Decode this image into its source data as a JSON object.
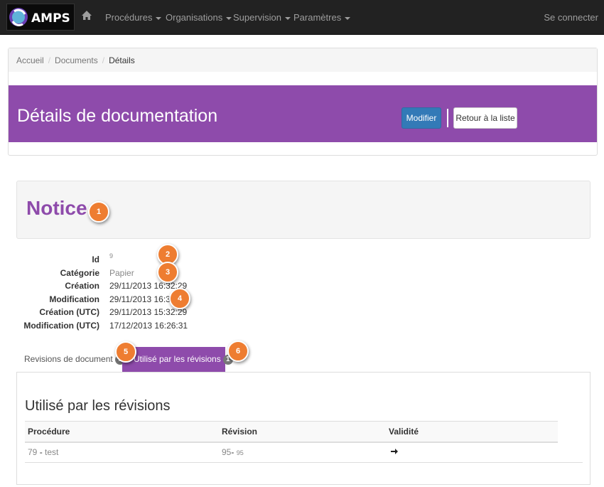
{
  "nav": {
    "logo_text": "AMPS",
    "items": [
      {
        "label": "Procédures"
      },
      {
        "label": "Organisations"
      },
      {
        "label": "Supervision"
      },
      {
        "label": "Paramètres"
      }
    ],
    "login": "Se connecter"
  },
  "breadcrumb": {
    "items": [
      "Accueil",
      "Documents"
    ],
    "active": "Détails"
  },
  "header": {
    "title": "Détails de documentation",
    "modify_label": "Modifier",
    "back_label": "Retour à la liste"
  },
  "notice": {
    "title": "Notice"
  },
  "details": [
    {
      "label": "Id",
      "value": "9"
    },
    {
      "label": "Catégorie",
      "value": "Papier"
    },
    {
      "label": "Création",
      "value": "29/11/2013 16:32:29"
    },
    {
      "label": "Modification",
      "value": "29/11/2013 16:32:29"
    },
    {
      "label": "Création (UTC)",
      "value": "29/11/2013 15:32:29"
    },
    {
      "label": "Modification (UTC)",
      "value": "17/12/2013 16:26:31"
    }
  ],
  "tabs": [
    {
      "label": "Revisions de document",
      "count": "1"
    },
    {
      "label": "Utilisé par les révisions",
      "count": "1"
    }
  ],
  "markers": [
    "1",
    "2",
    "3",
    "4",
    "5",
    "6"
  ],
  "section": {
    "title": "Utilisé par les révisions",
    "columns": [
      "Procédure",
      "Révision",
      "Validité"
    ],
    "rows": [
      {
        "procedure_id": "79",
        "procedure_sep": " - ",
        "procedure_name": "test",
        "revision": "95",
        "revision_sub": "95",
        "validity_icon": "arrow-right-icon"
      }
    ]
  },
  "colors": {
    "accent": "#8e4bab",
    "navbar": "#222222",
    "primary": "#337ab7",
    "marker": "#ee7d31"
  }
}
